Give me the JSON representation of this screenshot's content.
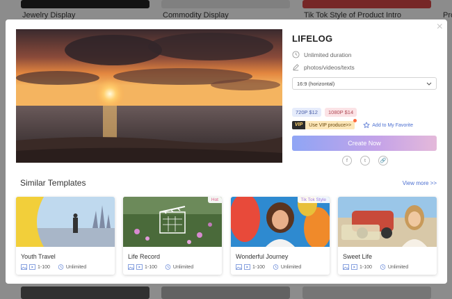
{
  "background": {
    "labels": [
      "Jewelry Display",
      "Commodity Display",
      "Tik Tok Style of Product Intro",
      "Pro"
    ]
  },
  "modal": {
    "close_glyph": "×",
    "template": {
      "title": "LIFELOG",
      "duration": "Unlimited duration",
      "media": "photos/videos/texts",
      "ratio": "16:9 (horizontal)",
      "price_720": "720P  $12",
      "price_1080": "1080P  $14",
      "vip_tag": "VIP",
      "vip_text": "Use VIP produce>>",
      "favorite": "Add to My Favorite",
      "create": "Create Now",
      "share": [
        "f",
        "t",
        "🔗"
      ]
    },
    "similar": {
      "title": "Similar Templates",
      "view_more": "View more >>",
      "cards": [
        {
          "name": "Youth Travel",
          "range": "1-100",
          "duration": "Unlimited",
          "badge": ""
        },
        {
          "name": "Life Record",
          "range": "1-100",
          "duration": "Unlimited",
          "badge": "Hot"
        },
        {
          "name": "Wonderful Journey",
          "range": "1-100",
          "duration": "Unlimited",
          "badge": "Tik Tok Style"
        },
        {
          "name": "Sweet Life",
          "range": "1-100",
          "duration": "Unlimited",
          "badge": ""
        }
      ]
    }
  },
  "colors": {
    "accent": "#4a6ed0",
    "button_gradient_start": "#8fa5f5",
    "button_gradient_end": "#e4b9da"
  },
  "icons": [
    "close-icon",
    "clock-icon",
    "pencil-icon",
    "chevron-down-icon",
    "star-icon",
    "facebook-icon",
    "twitter-icon",
    "link-icon",
    "image-icon",
    "video-icon"
  ]
}
